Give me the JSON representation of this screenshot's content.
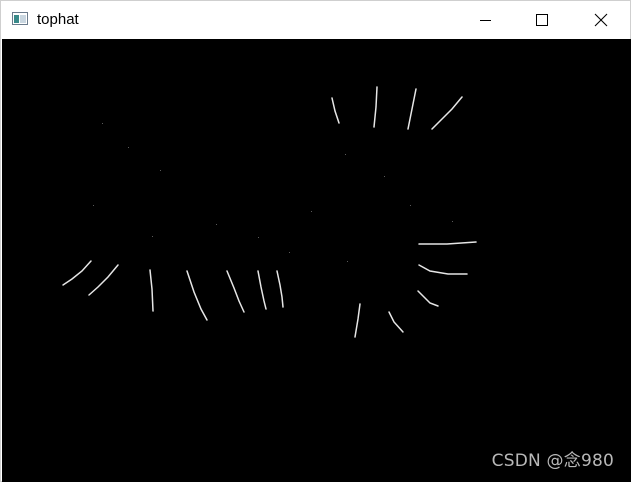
{
  "window": {
    "title": "tophat",
    "icon": "app-window-icon"
  },
  "controls": {
    "minimize_icon": "minimize-icon",
    "maximize_icon": "maximize-icon",
    "close_icon": "close-icon"
  },
  "image": {
    "description_colors": {
      "background": "#000000",
      "foreground": "#ffffff"
    }
  },
  "watermark": "CSDN @念980"
}
